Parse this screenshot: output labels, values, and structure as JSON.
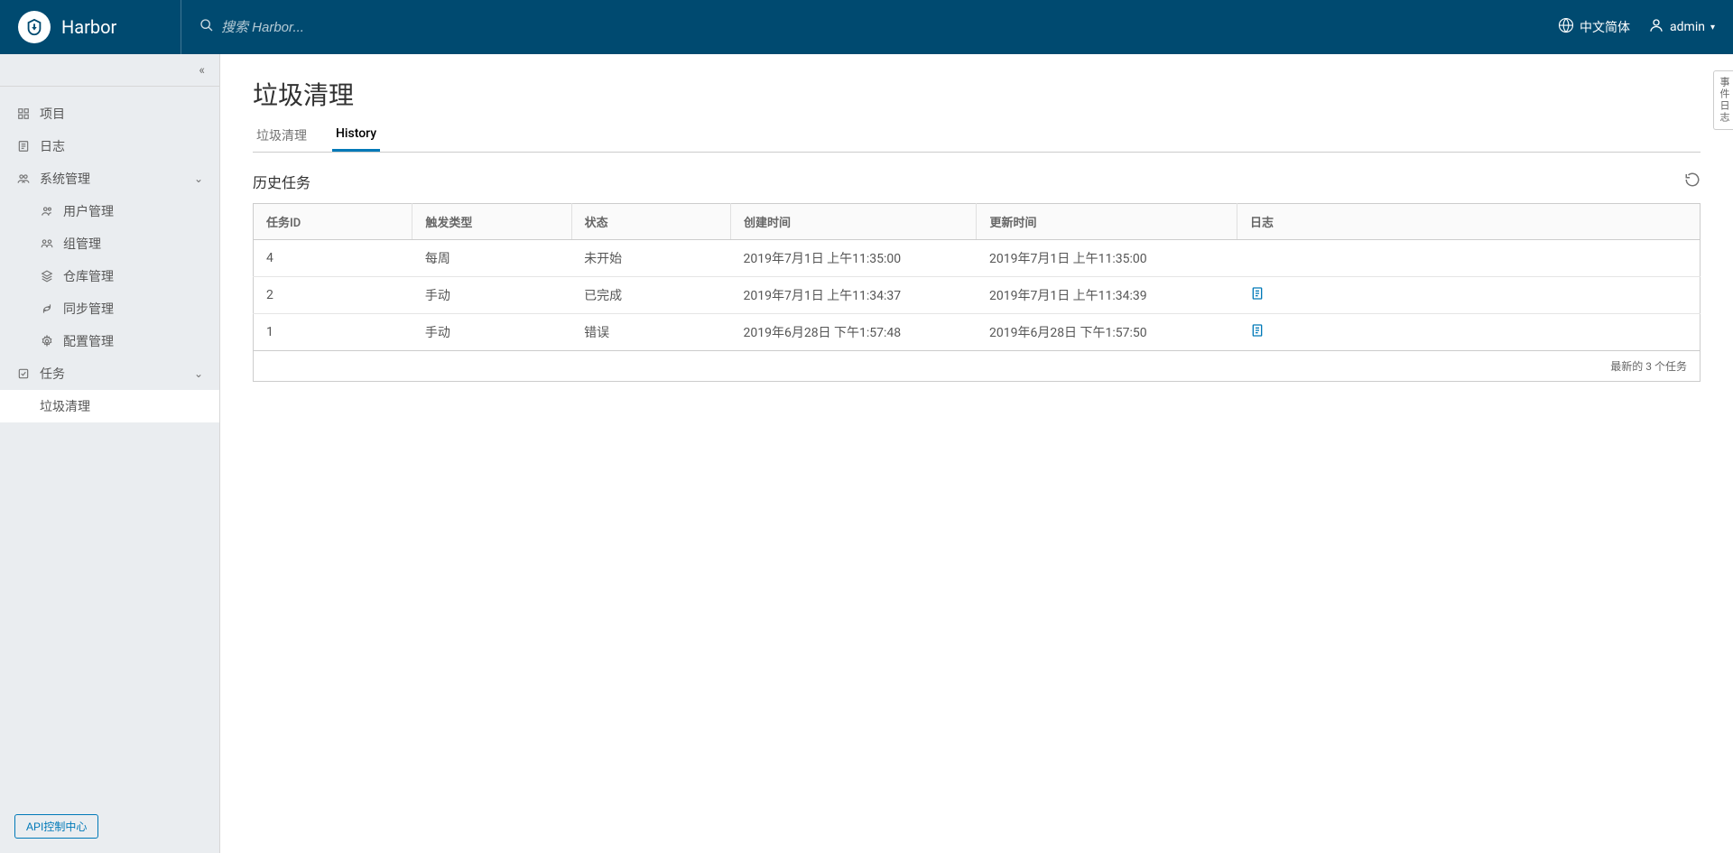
{
  "header": {
    "app_name": "Harbor",
    "search_placeholder": "搜索 Harbor...",
    "language_label": "中文简体",
    "username": "admin"
  },
  "sidebar": {
    "projects": "项目",
    "logs": "日志",
    "admin_label": "系统管理",
    "admin_items": {
      "users": "用户管理",
      "groups": "组管理",
      "repos": "仓库管理",
      "replication": "同步管理",
      "config": "配置管理"
    },
    "tasks_label": "任务",
    "gc": "垃圾清理",
    "api_button": "API控制中心"
  },
  "page": {
    "title": "垃圾清理",
    "tab_gc": "垃圾清理",
    "tab_history": "History",
    "section_title": "历史任务",
    "side_tab": "事件日志"
  },
  "table": {
    "headers": {
      "job_id": "任务ID",
      "trigger": "触发类型",
      "status": "状态",
      "created": "创建时间",
      "updated": "更新时间",
      "log": "日志"
    },
    "rows": [
      {
        "id": "4",
        "trigger": "每周",
        "status": "未开始",
        "created": "2019年7月1日 上午11:35:00",
        "updated": "2019年7月1日 上午11:35:00",
        "has_log": false
      },
      {
        "id": "2",
        "trigger": "手动",
        "status": "已完成",
        "created": "2019年7月1日 上午11:34:37",
        "updated": "2019年7月1日 上午11:34:39",
        "has_log": true
      },
      {
        "id": "1",
        "trigger": "手动",
        "status": "错误",
        "created": "2019年6月28日 下午1:57:48",
        "updated": "2019年6月28日 下午1:57:50",
        "has_log": true
      }
    ],
    "footer": "最新的 3 个任务"
  }
}
